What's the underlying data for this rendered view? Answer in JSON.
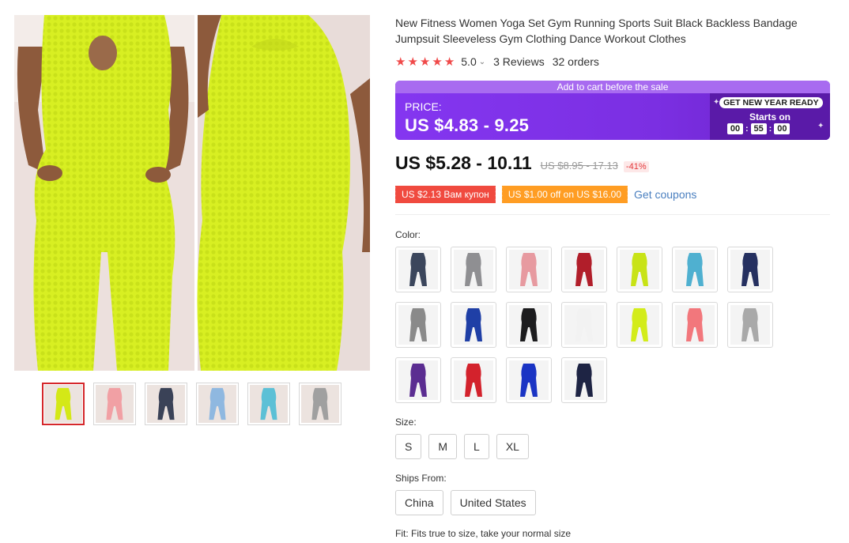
{
  "product": {
    "title": "New Fitness Women Yoga Set Gym Running Sports Suit Black Backless Bandage Jumpsuit Sleeveless Gym Clothing Dance Workout Clothes",
    "rating": "5.0",
    "rating_chevron": "⌄",
    "reviews": "3 Reviews",
    "orders": "32 orders"
  },
  "promo": {
    "banner_top": "Add to cart before the sale",
    "label": "PRICE:",
    "price": "US $4.83 - 9.25",
    "badge": "GET NEW YEAR READY",
    "starts_on": "Starts on",
    "timer": {
      "hours": "00",
      "minutes": "55",
      "seconds": "00",
      "sep": ":"
    },
    "colors": {
      "banner_top": "#a86bf0",
      "body": "#7b2fe2",
      "right": "#5a1aa8"
    }
  },
  "pricing": {
    "current": "US $5.28 - 10.11",
    "original": "US $8.95 - 17.13",
    "discount": "-41%"
  },
  "coupons": {
    "coupon1": "US $2.13 Вам купон",
    "coupon2": "US $1.00 off on US $16.00",
    "get_coupons": "Get coupons"
  },
  "color": {
    "label": "Color:",
    "options": [
      "navy-gray",
      "gray",
      "pink",
      "red",
      "neon-yellow",
      "sky-blue",
      "navy",
      "gray",
      "royal-blue",
      "black",
      "white",
      "neon-yellow",
      "coral-pink",
      "light-gray",
      "purple",
      "red",
      "royal-blue",
      "dark-navy"
    ]
  },
  "size": {
    "label": "Size:",
    "options": [
      "S",
      "M",
      "L",
      "XL"
    ]
  },
  "ships_from": {
    "label": "Ships From:",
    "options": [
      "China",
      "United States"
    ]
  },
  "fit": "Fit: Fits true to size, take your normal size",
  "gallery": {
    "thumb_colors": [
      "#d4e817",
      "#f1a0a4",
      "#3a4257",
      "#8fb8e0",
      "#5cc0d6",
      "#a0a0a0"
    ],
    "swatch_colors": [
      "#3b465c",
      "#8f8f92",
      "#e79aa0",
      "#b11e2a",
      "#c8e316",
      "#4fb0d0",
      "#253060",
      "#8a8a8a",
      "#1f3fa6",
      "#1c1c1e",
      "#f2f2f2",
      "#d3ec1a",
      "#f2777c",
      "#a9a9a9",
      "#5b2d91",
      "#d3222c",
      "#1a34c4",
      "#1e2444"
    ],
    "star_color": "#f04a4a",
    "accent": "#d5272b"
  }
}
